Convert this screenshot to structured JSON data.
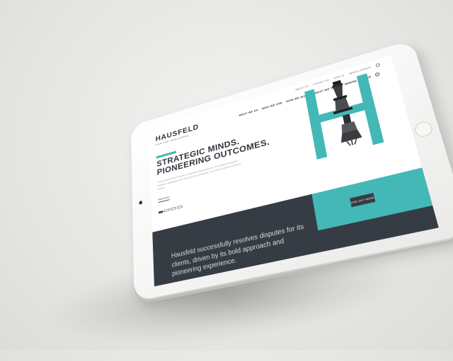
{
  "brand": {
    "name": "HAUSFELD",
    "tagline": "FOR THE CHALLENGE"
  },
  "utility_nav": [
    "ABOUT US",
    "CONTACT US",
    "SIGN UP",
    "NEWS & EVENTS"
  ],
  "main_nav": [
    "WHAT WE DO",
    "WHO WE ARE",
    "HOW WE WORK",
    "WHAT WE THINK",
    "WHERE WE ARE"
  ],
  "hero": {
    "headline_line1": "STRATEGIC MINDS.",
    "headline_line2": "PIONEERING OUTCOMES.",
    "body": "Lorem ipsum dolor sit amet, consectetur adipiscing elit. Ut in dignissim lacinia tincidunt, vestibulum ante ipsum primis in faucibus orci luctus et ultrices posuere cubilia.",
    "read_more": "Read more"
  },
  "band": {
    "tagline": "Hausfeld successfully resolves disputes for its clients, driven by its bold approach and pioneering experience.",
    "button": "FIND OUT MORE"
  },
  "colors": {
    "accent": "#43b8b7",
    "dark": "#363c44",
    "text": "#2f343a"
  }
}
